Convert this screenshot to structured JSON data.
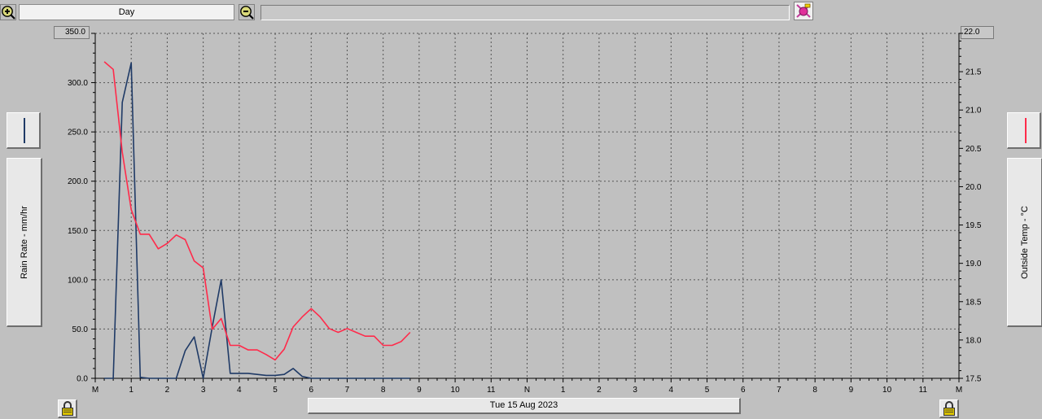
{
  "toolbar": {
    "period": "Day",
    "status_text": "",
    "zoom_in_icon": "zoom-in-icon",
    "zoom_out_icon": "zoom-out-icon",
    "tool_icon": "paint-tool-icon"
  },
  "left_axis": {
    "label": "Rain Rate - mm/hr",
    "series_color": "#1f3a66"
  },
  "right_axis": {
    "label": "Outside Temp - °C",
    "series_color": "#ff2a4a"
  },
  "date_label": "Tue 15 Aug 2023",
  "lock_icon": "padlock-icon",
  "chart_data": {
    "type": "line",
    "x_unit": "hour of day",
    "xlim": [
      0,
      24
    ],
    "x_tick_labels": [
      "M",
      "1",
      "2",
      "3",
      "4",
      "5",
      "6",
      "7",
      "8",
      "9",
      "10",
      "11",
      "N",
      "1",
      "2",
      "3",
      "4",
      "5",
      "6",
      "7",
      "8",
      "9",
      "10",
      "11",
      "M"
    ],
    "left_axis": {
      "label": "Rain Rate - mm/hr",
      "ylim": [
        0,
        350
      ],
      "tick_labels": [
        "0.0",
        "50.0",
        "100.0",
        "150.0",
        "200.0",
        "250.0",
        "300.0",
        "350.0"
      ]
    },
    "right_axis": {
      "label": "Outside Temp - °C",
      "ylim": [
        17.5,
        22.0
      ],
      "tick_labels": [
        "17.5",
        "18.0",
        "18.5",
        "19.0",
        "19.5",
        "20.0",
        "20.5",
        "21.0",
        "21.5",
        "22.0"
      ]
    },
    "grid": true,
    "series": [
      {
        "name": "Rain Rate - mm/hr",
        "axis": "left",
        "color": "#1f3a66",
        "x": [
          0.25,
          0.5,
          0.75,
          1.0,
          1.25,
          1.5,
          1.75,
          2.0,
          2.25,
          2.5,
          2.75,
          3.0,
          3.25,
          3.5,
          3.75,
          4.0,
          4.25,
          4.5,
          4.75,
          5.0,
          5.25,
          5.5,
          5.75,
          6.0,
          6.25,
          6.5,
          6.75,
          7.0,
          7.25,
          7.5,
          7.75,
          8.0,
          8.25,
          8.5,
          8.75
        ],
        "y": [
          0,
          0,
          280,
          320,
          1,
          0,
          0,
          0,
          0,
          28,
          42,
          0,
          52,
          100,
          5,
          5,
          5,
          4,
          3,
          3,
          4,
          10,
          2,
          0,
          0,
          0,
          0,
          0,
          0,
          0,
          0,
          0,
          0,
          0,
          0
        ]
      },
      {
        "name": "Outside Temp - °C",
        "axis": "right",
        "color": "#ff2a4a",
        "x": [
          0.25,
          0.5,
          0.75,
          1.0,
          1.25,
          1.5,
          1.75,
          2.0,
          2.25,
          2.5,
          2.75,
          3.0,
          3.25,
          3.5,
          3.75,
          4.0,
          4.25,
          4.5,
          4.75,
          5.0,
          5.25,
          5.5,
          5.75,
          6.0,
          6.25,
          6.5,
          6.75,
          7.0,
          7.25,
          7.5,
          7.75,
          8.0,
          8.25,
          8.5,
          8.75
        ],
        "y": [
          21.63,
          21.53,
          20.45,
          19.7,
          19.38,
          19.38,
          19.19,
          19.26,
          19.37,
          19.31,
          19.03,
          18.94,
          18.14,
          18.28,
          17.93,
          17.93,
          17.87,
          17.87,
          17.81,
          17.74,
          17.88,
          18.17,
          18.3,
          18.41,
          18.3,
          18.15,
          18.1,
          18.15,
          18.1,
          18.05,
          18.05,
          17.93,
          17.93,
          17.98,
          18.1
        ]
      }
    ]
  }
}
